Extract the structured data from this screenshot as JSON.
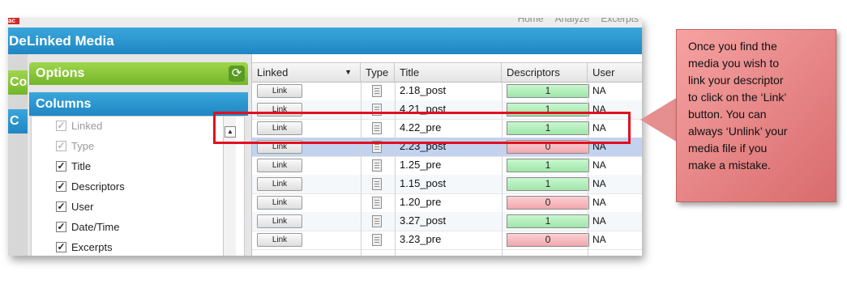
{
  "top_nav": [
    "Home",
    "Analyze",
    "Excerpts"
  ],
  "badge_text": "ac",
  "window": {
    "title": "Linked Media",
    "behind_title": "De"
  },
  "left_stubs": [
    "Co",
    "C"
  ],
  "options": {
    "label": "Options",
    "refresh_icon": "refresh-icon"
  },
  "columns": {
    "label": "Columns",
    "items": [
      {
        "label": "Linked",
        "checked": true,
        "disabled": true
      },
      {
        "label": "Type",
        "checked": true,
        "disabled": true
      },
      {
        "label": "Title",
        "checked": true,
        "disabled": false
      },
      {
        "label": "Descriptors",
        "checked": true,
        "disabled": false
      },
      {
        "label": "User",
        "checked": true,
        "disabled": false
      },
      {
        "label": "Date/Time",
        "checked": true,
        "disabled": false
      },
      {
        "label": "Excerpts",
        "checked": true,
        "disabled": false
      }
    ]
  },
  "table": {
    "headers": [
      "Linked",
      "Type",
      "Title",
      "Descriptors",
      "User"
    ],
    "rows": [
      {
        "link": "Link",
        "title": "2.18_post",
        "descriptors": "1",
        "user": "NA"
      },
      {
        "link": "Link",
        "title": "4.21_post",
        "descriptors": "1",
        "user": "NA"
      },
      {
        "link": "Link",
        "title": "4.22_pre",
        "descriptors": "1",
        "user": "NA"
      },
      {
        "link": "Link",
        "title": "2.23_post",
        "descriptors": "0",
        "user": "NA"
      },
      {
        "link": "Link",
        "title": "1.25_pre",
        "descriptors": "1",
        "user": "NA"
      },
      {
        "link": "Link",
        "title": "1.15_post",
        "descriptors": "1",
        "user": "NA"
      },
      {
        "link": "Link",
        "title": "1.20_pre",
        "descriptors": "0",
        "user": "NA"
      },
      {
        "link": "Link",
        "title": "3.27_post",
        "descriptors": "1",
        "user": "NA"
      },
      {
        "link": "Link",
        "title": "3.23_pre",
        "descriptors": "0",
        "user": "NA"
      }
    ],
    "selected_row": 3
  },
  "callout": {
    "text": "Once you find the\nmedia you wish to\nlink your descriptor\nto click on the ‘Link’\nbutton. You can\nalways ‘Unlink’ your\nmedia file if you\nmake a mistake."
  },
  "colors": {
    "title_blue": "#1f86c3",
    "options_green": "#74b52a",
    "descriptor_positive": "#9fe6a9",
    "descriptor_zero": "#f1a7ad",
    "highlight_red": "#e0101f",
    "callout_pink": "#e58f90"
  }
}
